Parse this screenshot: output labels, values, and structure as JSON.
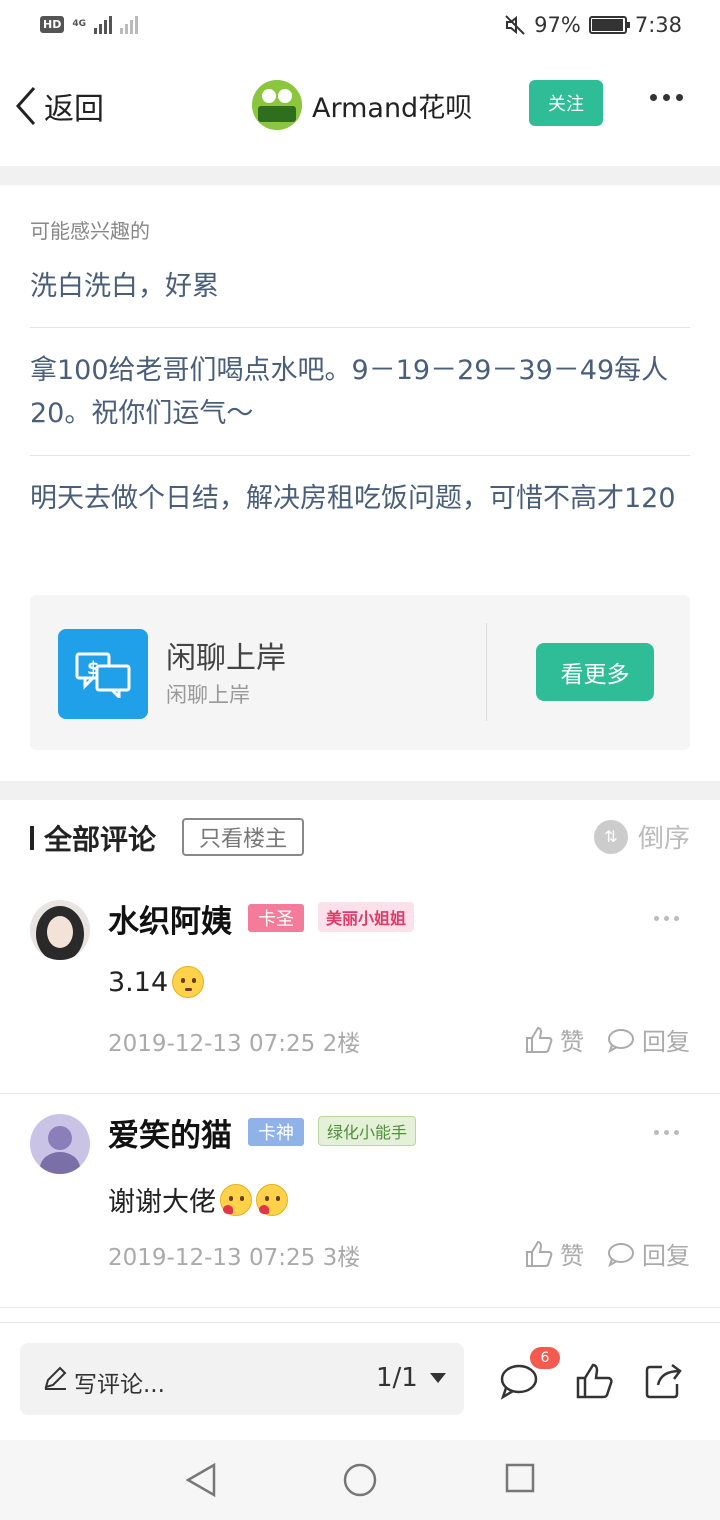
{
  "status_bar": {
    "hd": "HD",
    "network": "4G",
    "battery": "97%",
    "battery_level": 0.97,
    "time": "7:38"
  },
  "nav": {
    "back_label": "返回",
    "author_name": "Armand花呗",
    "follow_label": "关注"
  },
  "interest": {
    "label": "可能感兴趣的",
    "items": [
      "洗白洗白，好累",
      "拿100给老哥们喝点水吧。9－19－29－39－49每人20。祝你们运气～",
      "明天去做个日结，解决房租吃饭问题，可惜不高才120"
    ],
    "forum": {
      "name": "闲聊上岸",
      "subtitle": "闲聊上岸",
      "button": "看更多"
    }
  },
  "comments_section": {
    "title": "全部评论",
    "only_host": "只看楼主",
    "order": "倒序"
  },
  "comments": [
    {
      "name": "水织阿姨",
      "badge": "卡圣",
      "badge_color": "#f47b9a",
      "title": "美丽小姐姐",
      "text": "3.14",
      "time": "2019-12-13 07:25",
      "floor": "2楼",
      "like": "赞",
      "reply": "回复"
    },
    {
      "name": "爱笑的猫",
      "badge": "卡神",
      "badge_color": "#8fb3e8",
      "title": "绿化小能手",
      "text": "谢谢大佬",
      "time": "2019-12-13 07:25",
      "floor": "3楼",
      "like": "赞",
      "reply": "回复"
    }
  ],
  "bottom_bar": {
    "write_placeholder": "写评论...",
    "page": "1/1",
    "comment_count": "6"
  },
  "colors": {
    "accent_green": "#2fbd97",
    "link_blue": "#4a5e7a",
    "forum_blue": "#1fa0e8",
    "badge_red": "#f45b50"
  }
}
